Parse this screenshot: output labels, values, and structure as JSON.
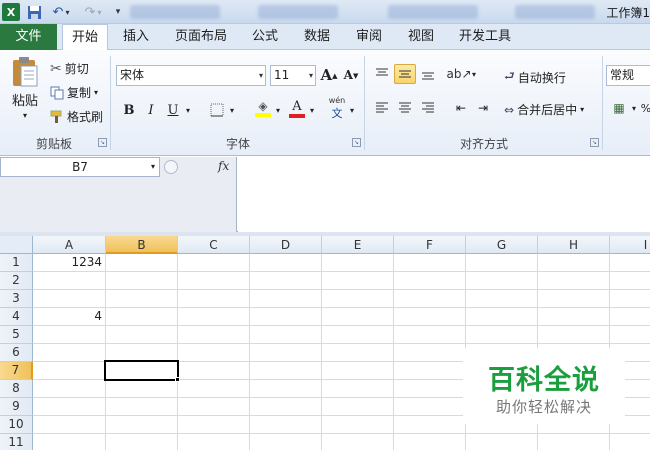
{
  "window": {
    "title": "工作簿1",
    "app_logo": "X"
  },
  "quick_access": {
    "save_icon": "save-icon",
    "undo_icon": "undo-icon",
    "redo_icon": "redo-icon"
  },
  "tabs": [
    {
      "label": "文件"
    },
    {
      "label": "开始"
    },
    {
      "label": "插入"
    },
    {
      "label": "页面布局"
    },
    {
      "label": "公式"
    },
    {
      "label": "数据"
    },
    {
      "label": "审阅"
    },
    {
      "label": "视图"
    },
    {
      "label": "开发工具"
    }
  ],
  "clipboard": {
    "paste_label": "粘贴",
    "cut_label": "剪切",
    "copy_label": "复制",
    "format_painter_label": "格式刷",
    "group_label": "剪贴板"
  },
  "font": {
    "font_name": "宋体",
    "font_size": "11",
    "bold": "B",
    "italic": "I",
    "underline": "U",
    "group_label": "字体",
    "grow": "A",
    "shrink": "A",
    "font_color_letter": "A",
    "font_color": "#e02020",
    "fill_color": "#ffff00",
    "phonetic_label": "wén"
  },
  "alignment": {
    "wrap_text_label": "自动换行",
    "merge_center_label": "合并后居中",
    "group_label": "对齐方式"
  },
  "number": {
    "format_value": "常规"
  },
  "formula_bar": {
    "name_box": "B7",
    "fx": "fx",
    "content": ""
  },
  "grid": {
    "columns": [
      "A",
      "B",
      "C",
      "D",
      "E",
      "F",
      "G",
      "H",
      "I"
    ],
    "rows": [
      "1",
      "2",
      "3",
      "4",
      "5",
      "6",
      "7",
      "8",
      "9",
      "10",
      "11"
    ],
    "cells": {
      "A1": "1234",
      "A4": "4"
    },
    "selected_cell": "B7"
  },
  "watermark": {
    "title": "百科全说",
    "subtitle": "助你轻松解决"
  }
}
